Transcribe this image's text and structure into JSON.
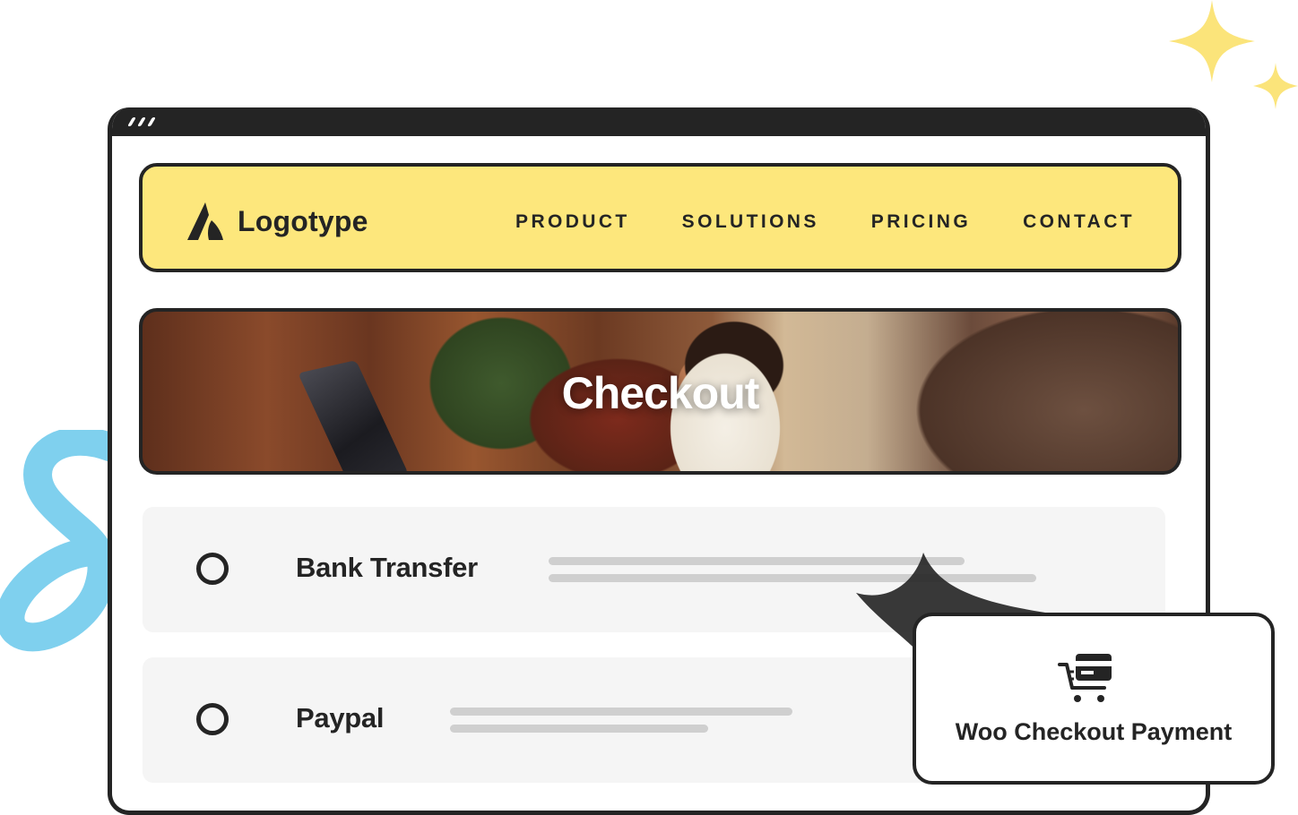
{
  "brand": {
    "logo_text": "Logotype",
    "colors": {
      "nav_yellow": "#fde77c",
      "frame_dark": "#242424",
      "accent_blue": "#7fd0ee",
      "sparkle_yellow": "#fbe47a"
    }
  },
  "nav": {
    "items": [
      {
        "label": "PRODUCT"
      },
      {
        "label": "SOLUTIONS"
      },
      {
        "label": "PRICING"
      },
      {
        "label": "CONTACT"
      }
    ]
  },
  "hero": {
    "title": "Checkout"
  },
  "payment_methods": [
    {
      "label": "Bank Transfer",
      "selected": false
    },
    {
      "label": "Paypal",
      "selected": false
    }
  ],
  "feature_card": {
    "label": "Woo Checkout Payment",
    "icon": "cart-card-icon"
  }
}
